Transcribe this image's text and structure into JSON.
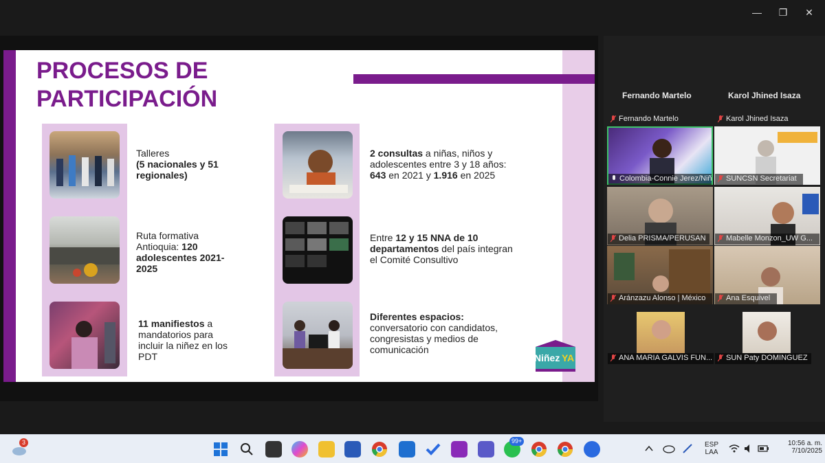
{
  "window": {
    "minimize": "—",
    "restore": "❐",
    "close": "✕"
  },
  "slide": {
    "title_line1": "PROCESOS DE",
    "title_line2": "PARTICIPACIÓN",
    "items": [
      {
        "pre": "Talleres",
        "bold": "(5 nacionales y 51 regionales)",
        "post": ""
      },
      {
        "pre": "Ruta formativa Antioquia: ",
        "bold": "120 adolescentes 2021-2025",
        "post": ""
      },
      {
        "pre": "",
        "bold": "11 manifiestos",
        "post": " a mandatorios para incluir la niñez en los PDT"
      },
      {
        "bold_a": "2 consultas",
        "text_a": " a niñas, niños y adolescentes entre 3 y 18 años: ",
        "bold_b": "643",
        "text_b": " en 2021 y ",
        "bold_c": "1.916",
        "text_c": " en 2025"
      },
      {
        "text_a": "Entre ",
        "bold_a": "12 y 15 NNA de 10 departamentos",
        "text_b": " del país integran el Comité Consultivo"
      },
      {
        "bold_a": "Diferentes espacios:",
        "text_a": " conversatorio con candidatos, congresistas y medios de comunicación"
      }
    ],
    "logo_text_1": "Niñez",
    "logo_text_2": "YA"
  },
  "gallery": {
    "header_left": "Fernando Martelo",
    "header_right": "Karol Jhined Isaza",
    "participants": [
      "Fernando Martelo",
      "Karol Jhined Isaza",
      "Colombia-Connie Jerez/Niñ...",
      "SUNCSN Secretariat",
      "Delia PRISMA/PERUSAN",
      "Mabelle Monzon_UW G...",
      "Aránzazu Alonso | México",
      "Ana Esquivel",
      "ANA MARIA GALVIS FUN...",
      "SUN Paty DOMINGUEZ"
    ]
  },
  "taskbar": {
    "weather_badge": "3",
    "whatsapp_badge": "99+",
    "lang_line1": "ESP",
    "lang_line2": "LAA",
    "time": "10:56 a. m.",
    "date": "7/10/2025"
  }
}
